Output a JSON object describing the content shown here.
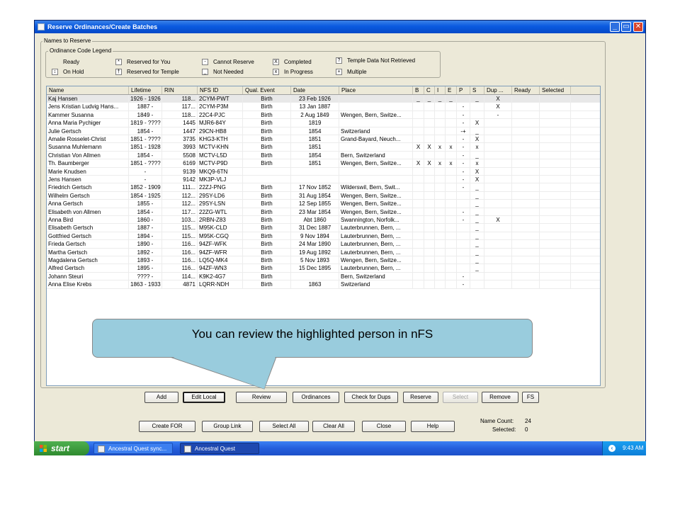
{
  "window": {
    "title": "Reserve Ordinances/Create Batches",
    "minimize": "_",
    "maximize": "▭",
    "close": "✕"
  },
  "names_group": {
    "label": "Names to Reserve"
  },
  "legend": {
    "label": "Ordinance Code Legend",
    "items": [
      {
        "symbol": "",
        "text": "Ready"
      },
      {
        "symbol": "*",
        "text": "Reserved for You"
      },
      {
        "symbol": "-",
        "text": "Cannot Reserve"
      },
      {
        "symbol": "X",
        "text": "Completed"
      },
      {
        "symbol": "?",
        "text": "Temple Data Not Retrieved"
      },
      {
        "symbol": "↕",
        "text": "On Hold"
      },
      {
        "symbol": "†",
        "text": "Reserved for Temple"
      },
      {
        "symbol": "_",
        "text": "Not Needed"
      },
      {
        "symbol": "x",
        "text": "In Progress"
      },
      {
        "symbol": "+",
        "text": "Multiple"
      }
    ]
  },
  "table": {
    "columns": [
      "Name",
      "Lifetime",
      "RIN",
      "NFS ID",
      "Qual. Event",
      "Date",
      "Place",
      "B",
      "C",
      "I",
      "E",
      "P",
      "S",
      "Dup ...",
      "Ready",
      "Selected"
    ],
    "rows": [
      [
        "Kaj Hansen",
        "1926 - 1926",
        "118...",
        "2CYM-PWT",
        "Birth",
        "23 Feb 1926",
        "",
        "_",
        "_",
        "_",
        "_",
        "",
        "_",
        "X",
        "",
        ""
      ],
      [
        "Jens Kristian Ludvig Hans...",
        "1887 -",
        "117...",
        "2CYM-P3M",
        "Birth",
        "13 Jan 1887",
        "",
        "",
        "",
        "",
        "",
        "-",
        "",
        "X",
        "",
        ""
      ],
      [
        "Kammer Susanna",
        "1849 -",
        "118...",
        "22C4-PJC",
        "Birth",
        "2 Aug 1849",
        "Wengen, Bern, Switze...",
        "",
        "",
        "",
        "",
        "-",
        "",
        "-",
        "",
        ""
      ],
      [
        "Anna Maria Pychiger",
        "1819 - ????",
        "1445",
        "MJR6-84Y",
        "Birth",
        "1819",
        "",
        "",
        "",
        "",
        "",
        "-",
        "X",
        "",
        "",
        ""
      ],
      [
        "Julie Gertsch",
        "1854 -",
        "1447",
        "29CN-HB8",
        "Birth",
        "1854",
        "Switzerland",
        "",
        "",
        "",
        "",
        "-+",
        "_",
        "",
        "",
        ""
      ],
      [
        "Amalie Rosselet-Christ",
        "1851 - ????",
        "3735",
        "KHG3-KTH",
        "Birth",
        "1851",
        "Grand-Bayard, Neuch...",
        "",
        "",
        "",
        "",
        "-",
        "X",
        "",
        "",
        ""
      ],
      [
        "Susanna Muhlemann",
        "1851 - 1928",
        "3993",
        "MCTV-KHN",
        "Birth",
        "1851",
        "",
        "X",
        "X",
        "x",
        "x",
        "-",
        "x",
        "",
        "",
        ""
      ],
      [
        "Christian Von Allmen",
        "1854 -",
        "5508",
        "MCTV-L5D",
        "Birth",
        "1854",
        "Bern, Switzerland",
        "",
        "",
        "",
        "",
        "-",
        "_",
        "",
        "",
        ""
      ],
      [
        "Th. Baumberger",
        "1851 - ????",
        "6169",
        "MCTV-P9D",
        "Birth",
        "1851",
        "Wengen, Bern, Switze...",
        "X",
        "X",
        "x",
        "x",
        "-",
        "x",
        "",
        "",
        ""
      ],
      [
        "Marie Knudsen",
        "-",
        "9139",
        "MKQ9-6TN",
        "",
        "",
        "",
        "",
        "",
        "",
        "",
        "-",
        "X",
        "",
        "",
        ""
      ],
      [
        "Jens Hansen",
        "-",
        "9142",
        "MK3P-VLJ",
        "",
        "",
        "",
        "",
        "",
        "",
        "",
        "-",
        "X",
        "",
        "",
        ""
      ],
      [
        "Friedrich Gertsch",
        "1852 - 1909",
        "111...",
        "22ZJ-PNG",
        "Birth",
        "17 Nov 1852",
        "Wilderswil, Bern, Swit...",
        "",
        "",
        "",
        "",
        "-",
        "_",
        "",
        "",
        ""
      ],
      [
        "Wilhelm Gertsch",
        "1854 - 1925",
        "112...",
        "29SY-LD6",
        "Birth",
        "31 Aug 1854",
        "Wengen, Bern, Switze...",
        "",
        "",
        "",
        "",
        "",
        "_",
        "",
        "",
        ""
      ],
      [
        "Anna Gertsch",
        "1855 -",
        "112...",
        "29SY-LSN",
        "Birth",
        "12 Sep 1855",
        "Wengen, Bern, Switze...",
        "",
        "",
        "",
        "",
        "",
        "_",
        "",
        "",
        ""
      ],
      [
        "Elisabeth von Allmen",
        "1854 -",
        "117...",
        "22ZG-WTL",
        "Birth",
        "23 Mar 1854",
        "Wengen, Bern, Switze...",
        "",
        "",
        "",
        "",
        "-",
        "_",
        "",
        "",
        ""
      ],
      [
        "Anna Bird",
        "1860 -",
        "103...",
        "2RBN-Z83",
        "Birth",
        "Abt 1860",
        "Swannington, Norfolk...",
        "",
        "",
        "",
        "",
        "-",
        "_",
        "X",
        "",
        ""
      ],
      [
        "Elisabeth Gertsch",
        "1887 -",
        "115...",
        "M95K-CLD",
        "Birth",
        "31 Dec 1887",
        "Lauterbrunnen, Bern, ...",
        "",
        "",
        "",
        "",
        "",
        "_",
        "",
        "",
        ""
      ],
      [
        "Gottfried Gertsch",
        "1894 -",
        "115...",
        "M95K-CGQ",
        "Birth",
        "9 Nov 1894",
        "Lauterbrunnen, Bern, ...",
        "",
        "",
        "",
        "",
        "",
        "_",
        "",
        "",
        ""
      ],
      [
        "Frieda Gertsch",
        "1890 -",
        "116...",
        "94ZF-WFK",
        "Birth",
        "24 Mar 1890",
        "Lauterbrunnen, Bern, ...",
        "",
        "",
        "",
        "",
        "",
        "_",
        "",
        "",
        ""
      ],
      [
        "Martha Gertsch",
        "1892 -",
        "116...",
        "94ZF-WFR",
        "Birth",
        "19 Aug 1892",
        "Lauterbrunnen, Bern, ...",
        "",
        "",
        "",
        "",
        "",
        "_",
        "",
        "",
        ""
      ],
      [
        "Magdalena Gertsch",
        "1893 -",
        "116...",
        "LQ5Q-MK4",
        "Birth",
        "5 Nov 1893",
        "Wengen, Bern, Switze...",
        "",
        "",
        "",
        "",
        "",
        "_",
        "",
        "",
        ""
      ],
      [
        "Alfred Gertsch",
        "1895 -",
        "116...",
        "94ZF-WN3",
        "Birth",
        "15 Dec 1895",
        "Lauterbrunnen, Bern, ...",
        "",
        "",
        "",
        "",
        "",
        "_",
        "",
        "",
        ""
      ],
      [
        "Johann Steuri",
        "???? -",
        "114...",
        "K9K2-4G7",
        "Birth",
        "",
        "Bern, Switzerland",
        "",
        "",
        "",
        "",
        "-",
        "",
        "",
        "",
        ""
      ],
      [
        "Anna Elise Krebs",
        "1863 - 1933",
        "4871",
        "LQRR-NDH",
        "Birth",
        "1863",
        "Switzerland",
        "",
        "",
        "",
        "",
        "-",
        "",
        "",
        "",
        ""
      ]
    ]
  },
  "callout": {
    "text": "You can review the highlighted person in nFS"
  },
  "buttons_row1": [
    "Add",
    "Edit Local",
    "Review",
    "Ordinances",
    "Check for Dups",
    "Reserve",
    "Select",
    "Remove",
    "FS"
  ],
  "buttons_row2": [
    "Create FOR",
    "Group Link",
    "Select All",
    "Clear All",
    "Close",
    "Help"
  ],
  "status": {
    "name_count_label": "Name Count:",
    "name_count": "24",
    "selected_label": "Selected:",
    "selected": "0"
  },
  "taskbar": {
    "start": "start",
    "tasks": [
      "Ancestral Quest sync...",
      "Ancestral Quest"
    ],
    "clock": "9:43 AM"
  }
}
